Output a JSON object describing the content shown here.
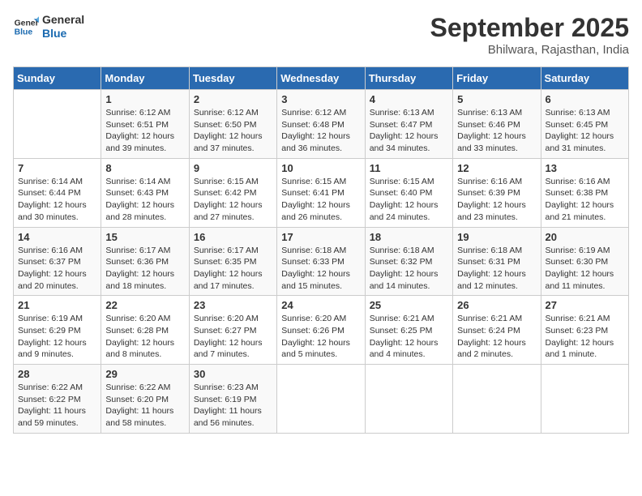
{
  "header": {
    "logo_line1": "General",
    "logo_line2": "Blue",
    "month": "September 2025",
    "location": "Bhilwara, Rajasthan, India"
  },
  "weekdays": [
    "Sunday",
    "Monday",
    "Tuesday",
    "Wednesday",
    "Thursday",
    "Friday",
    "Saturday"
  ],
  "weeks": [
    [
      {
        "day": "",
        "info": ""
      },
      {
        "day": "1",
        "info": "Sunrise: 6:12 AM\nSunset: 6:51 PM\nDaylight: 12 hours\nand 39 minutes."
      },
      {
        "day": "2",
        "info": "Sunrise: 6:12 AM\nSunset: 6:50 PM\nDaylight: 12 hours\nand 37 minutes."
      },
      {
        "day": "3",
        "info": "Sunrise: 6:12 AM\nSunset: 6:48 PM\nDaylight: 12 hours\nand 36 minutes."
      },
      {
        "day": "4",
        "info": "Sunrise: 6:13 AM\nSunset: 6:47 PM\nDaylight: 12 hours\nand 34 minutes."
      },
      {
        "day": "5",
        "info": "Sunrise: 6:13 AM\nSunset: 6:46 PM\nDaylight: 12 hours\nand 33 minutes."
      },
      {
        "day": "6",
        "info": "Sunrise: 6:13 AM\nSunset: 6:45 PM\nDaylight: 12 hours\nand 31 minutes."
      }
    ],
    [
      {
        "day": "7",
        "info": "Sunrise: 6:14 AM\nSunset: 6:44 PM\nDaylight: 12 hours\nand 30 minutes."
      },
      {
        "day": "8",
        "info": "Sunrise: 6:14 AM\nSunset: 6:43 PM\nDaylight: 12 hours\nand 28 minutes."
      },
      {
        "day": "9",
        "info": "Sunrise: 6:15 AM\nSunset: 6:42 PM\nDaylight: 12 hours\nand 27 minutes."
      },
      {
        "day": "10",
        "info": "Sunrise: 6:15 AM\nSunset: 6:41 PM\nDaylight: 12 hours\nand 26 minutes."
      },
      {
        "day": "11",
        "info": "Sunrise: 6:15 AM\nSunset: 6:40 PM\nDaylight: 12 hours\nand 24 minutes."
      },
      {
        "day": "12",
        "info": "Sunrise: 6:16 AM\nSunset: 6:39 PM\nDaylight: 12 hours\nand 23 minutes."
      },
      {
        "day": "13",
        "info": "Sunrise: 6:16 AM\nSunset: 6:38 PM\nDaylight: 12 hours\nand 21 minutes."
      }
    ],
    [
      {
        "day": "14",
        "info": "Sunrise: 6:16 AM\nSunset: 6:37 PM\nDaylight: 12 hours\nand 20 minutes."
      },
      {
        "day": "15",
        "info": "Sunrise: 6:17 AM\nSunset: 6:36 PM\nDaylight: 12 hours\nand 18 minutes."
      },
      {
        "day": "16",
        "info": "Sunrise: 6:17 AM\nSunset: 6:35 PM\nDaylight: 12 hours\nand 17 minutes."
      },
      {
        "day": "17",
        "info": "Sunrise: 6:18 AM\nSunset: 6:33 PM\nDaylight: 12 hours\nand 15 minutes."
      },
      {
        "day": "18",
        "info": "Sunrise: 6:18 AM\nSunset: 6:32 PM\nDaylight: 12 hours\nand 14 minutes."
      },
      {
        "day": "19",
        "info": "Sunrise: 6:18 AM\nSunset: 6:31 PM\nDaylight: 12 hours\nand 12 minutes."
      },
      {
        "day": "20",
        "info": "Sunrise: 6:19 AM\nSunset: 6:30 PM\nDaylight: 12 hours\nand 11 minutes."
      }
    ],
    [
      {
        "day": "21",
        "info": "Sunrise: 6:19 AM\nSunset: 6:29 PM\nDaylight: 12 hours\nand 9 minutes."
      },
      {
        "day": "22",
        "info": "Sunrise: 6:20 AM\nSunset: 6:28 PM\nDaylight: 12 hours\nand 8 minutes."
      },
      {
        "day": "23",
        "info": "Sunrise: 6:20 AM\nSunset: 6:27 PM\nDaylight: 12 hours\nand 7 minutes."
      },
      {
        "day": "24",
        "info": "Sunrise: 6:20 AM\nSunset: 6:26 PM\nDaylight: 12 hours\nand 5 minutes."
      },
      {
        "day": "25",
        "info": "Sunrise: 6:21 AM\nSunset: 6:25 PM\nDaylight: 12 hours\nand 4 minutes."
      },
      {
        "day": "26",
        "info": "Sunrise: 6:21 AM\nSunset: 6:24 PM\nDaylight: 12 hours\nand 2 minutes."
      },
      {
        "day": "27",
        "info": "Sunrise: 6:21 AM\nSunset: 6:23 PM\nDaylight: 12 hours\nand 1 minute."
      }
    ],
    [
      {
        "day": "28",
        "info": "Sunrise: 6:22 AM\nSunset: 6:22 PM\nDaylight: 11 hours\nand 59 minutes."
      },
      {
        "day": "29",
        "info": "Sunrise: 6:22 AM\nSunset: 6:20 PM\nDaylight: 11 hours\nand 58 minutes."
      },
      {
        "day": "30",
        "info": "Sunrise: 6:23 AM\nSunset: 6:19 PM\nDaylight: 11 hours\nand 56 minutes."
      },
      {
        "day": "",
        "info": ""
      },
      {
        "day": "",
        "info": ""
      },
      {
        "day": "",
        "info": ""
      },
      {
        "day": "",
        "info": ""
      }
    ]
  ]
}
